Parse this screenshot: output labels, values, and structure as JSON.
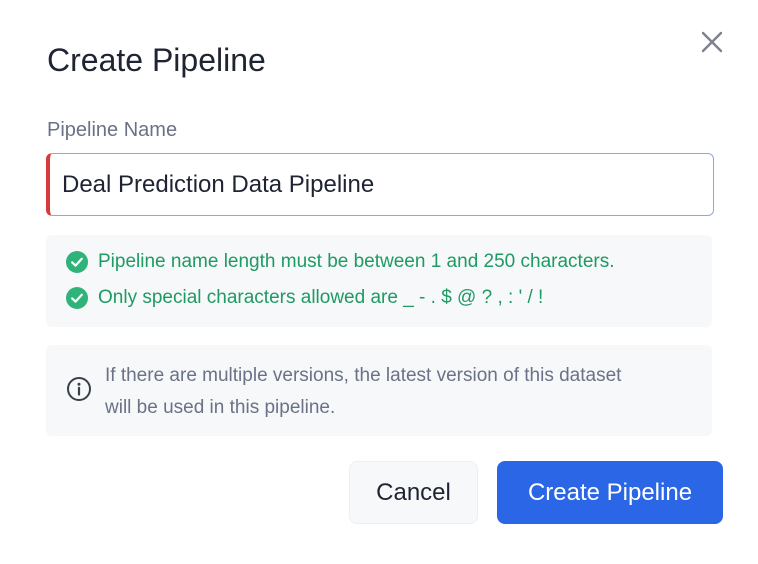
{
  "dialog": {
    "title": "Create Pipeline",
    "close_icon": "close-icon"
  },
  "form": {
    "name_label": "Pipeline Name",
    "name_value": "Deal Prediction Data Pipeline"
  },
  "validation": {
    "rules": [
      {
        "text": "Pipeline name length must be between 1 and 250 characters.",
        "icon": "check-circle-icon",
        "status": "passed"
      },
      {
        "text": "Only special characters allowed are _ - . $ @ ? , : ' / !",
        "icon": "check-circle-icon",
        "status": "passed"
      }
    ]
  },
  "info": {
    "icon": "info-icon",
    "text_line1": "If there are multiple versions, the latest version of this dataset",
    "text_line2": "will be used in this pipeline."
  },
  "actions": {
    "cancel_label": "Cancel",
    "create_label": "Create Pipeline"
  },
  "colors": {
    "accent": "#2a66e6",
    "error_bar": "#d63a3a",
    "success": "#1f9a63",
    "muted_text": "#6a7285"
  }
}
